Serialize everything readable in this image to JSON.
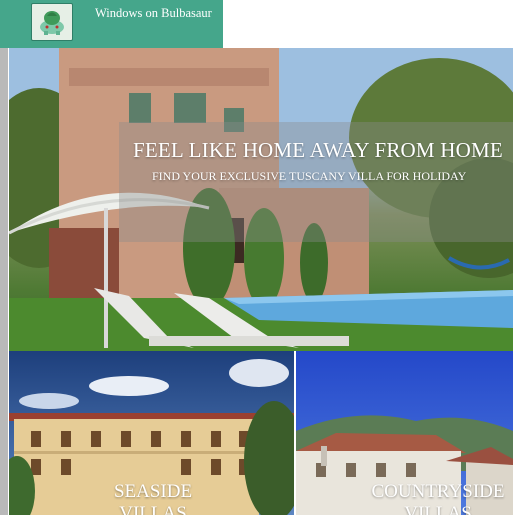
{
  "brand": {
    "name": "Windows on Bulbasaur",
    "logo_icon": "bulbasaur-logo",
    "color": "#45a68b"
  },
  "hero": {
    "title": "FEEL LIKE HOME AWAY FROM HOME",
    "subtitle": "FIND YOUR EXCLUSIVE TUSCANY VILLA FOR HOLIDAY"
  },
  "cards": [
    {
      "label": "SEASIDE VILLAS"
    },
    {
      "label": "COUNTRYSIDE VILLAS"
    }
  ]
}
